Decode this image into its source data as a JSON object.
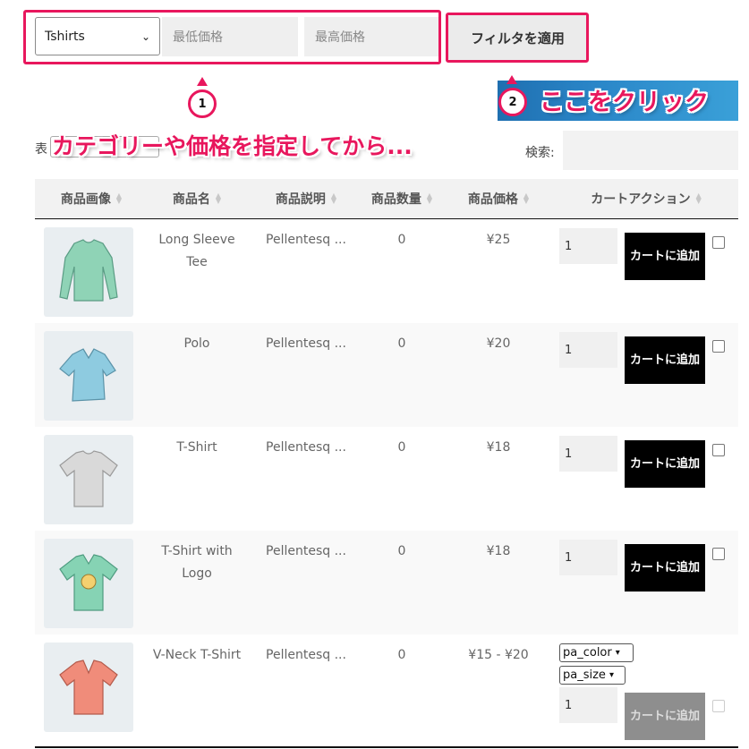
{
  "filter": {
    "category_value": "Tshirts",
    "min_price_placeholder": "最低価格",
    "max_price_placeholder": "最高価格",
    "apply_label": "フィルタを適用"
  },
  "annotations": {
    "badge_1": "1",
    "badge_2": "2",
    "callout_1": "カテゴリーや価格を指定してから...",
    "callout_2": "ここをクリック",
    "accent_color": "#e8175d"
  },
  "table_controls": {
    "show_label": "表",
    "search_label": "検索:"
  },
  "columns": [
    "商品画像",
    "商品名",
    "商品説明",
    "商品数量",
    "商品価格",
    "カートアクション"
  ],
  "rows": [
    {
      "name": "Long Sleeve\nTee",
      "description": "Pellentesq ...",
      "quantity": "0",
      "price": "¥25",
      "qty_value": "1",
      "cart_label": "カートに追加",
      "image_icon": "long-sleeve-tee-image",
      "image_color": "#8fd3b6"
    },
    {
      "name": "Polo",
      "description": "Pellentesq ...",
      "quantity": "0",
      "price": "¥20",
      "qty_value": "1",
      "cart_label": "カートに追加",
      "image_icon": "polo-image",
      "image_color": "#8ecbe0"
    },
    {
      "name": "T-Shirt",
      "description": "Pellentesq ...",
      "quantity": "0",
      "price": "¥18",
      "qty_value": "1",
      "cart_label": "カートに追加",
      "image_icon": "tshirt-image",
      "image_color": "#d9d9d9"
    },
    {
      "name": "T-Shirt with\nLogo",
      "description": "Pellentesq ...",
      "quantity": "0",
      "price": "¥18",
      "qty_value": "1",
      "cart_label": "カートに追加",
      "image_icon": "tshirt-logo-image",
      "image_color": "#86d3b4"
    },
    {
      "name": "V-Neck T-Shirt",
      "description": "Pellentesq ...",
      "quantity": "0",
      "price": "¥15 - ¥20",
      "qty_value": "1",
      "cart_label": "カートに追加",
      "image_icon": "vneck-tshirt-image",
      "image_color": "#f08c7a",
      "color_select": "pa_color",
      "size_select": "pa_size"
    }
  ]
}
